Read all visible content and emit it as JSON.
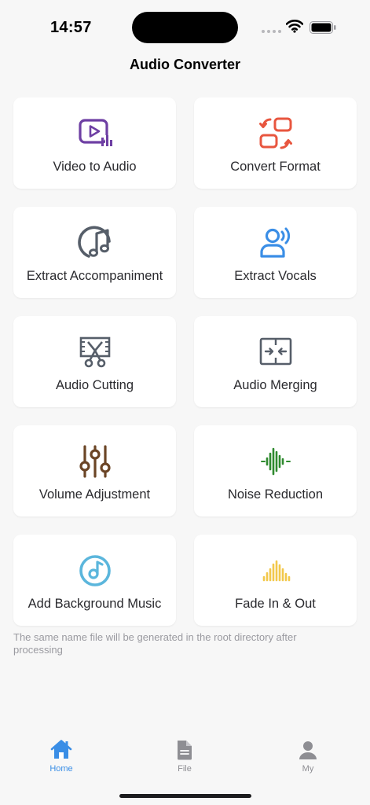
{
  "status": {
    "time": "14:57"
  },
  "nav": {
    "title": "Audio Converter"
  },
  "colors": {
    "purple": "#6e3fa3",
    "red": "#e8563f",
    "slate": "#565e69",
    "blue": "#3a8ee6",
    "brown": "#6b4526",
    "green": "#2f8a2f",
    "teal": "#5bb6dc",
    "yellow": "#f2c84b",
    "tab_active": "#3a8ee6",
    "tab_inactive": "#8e8e93"
  },
  "features": [
    {
      "label": "Video to Audio",
      "icon": "video-play-icon"
    },
    {
      "label": "Convert Format",
      "icon": "convert-arrows-icon"
    },
    {
      "label": "Extract Accompaniment",
      "icon": "music-note-icon"
    },
    {
      "label": "Extract Vocals",
      "icon": "person-voice-icon"
    },
    {
      "label": "Audio Cutting",
      "icon": "scissors-icon"
    },
    {
      "label": "Audio Merging",
      "icon": "merge-arrows-icon"
    },
    {
      "label": "Volume Adjustment",
      "icon": "equalizer-sliders-icon"
    },
    {
      "label": "Noise Reduction",
      "icon": "waveform-icon"
    },
    {
      "label": "Add Background Music",
      "icon": "music-disc-icon"
    },
    {
      "label": "Fade In & Out",
      "icon": "fade-bars-icon"
    }
  ],
  "note": "The same name file will be generated in the root directory after processing",
  "tabs": [
    {
      "label": "Home",
      "icon": "home-icon",
      "active": true
    },
    {
      "label": "File",
      "icon": "file-icon",
      "active": false
    },
    {
      "label": "My",
      "icon": "person-icon",
      "active": false
    }
  ]
}
